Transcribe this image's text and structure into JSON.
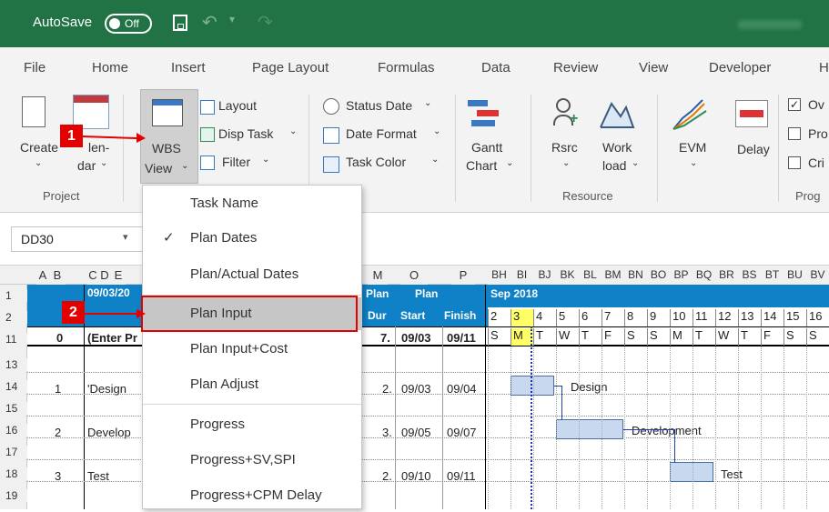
{
  "titlebar": {
    "autosave_label": "AutoSave",
    "toggle_label": "Off"
  },
  "tabs": [
    "File",
    "Home",
    "Insert",
    "Page Layout",
    "Formulas",
    "Data",
    "Review",
    "View",
    "Developer",
    "H"
  ],
  "ribbon": {
    "project": {
      "create": "Create",
      "calendar_line1": "len-",
      "calendar_line2": "dar",
      "group": "Project"
    },
    "wbs": {
      "line1": "WBS",
      "line2": "View"
    },
    "layout": "Layout",
    "disp_task": "Disp Task",
    "filter": "Filter",
    "status_date": "Status Date",
    "date_format": "Date Format",
    "task_color": "Task Color",
    "gantt_line1": "Gantt",
    "gantt_line2": "Chart",
    "rsrc": "Rsrc",
    "work_line1": "Work",
    "work_line2": "load",
    "resource_group": "Resource",
    "evm": "EVM",
    "delay": "Delay",
    "checks": [
      "Ov",
      "Pro",
      "Cri"
    ],
    "prog_group": "Prog"
  },
  "namebox": "DD30",
  "callouts": [
    "1",
    "2"
  ],
  "menu": {
    "items": [
      {
        "label": "Task Name",
        "checked": false
      },
      {
        "label": "Plan Dates",
        "checked": true
      },
      {
        "label": "Plan/Actual Dates",
        "checked": false
      },
      {
        "label": "Plan Input",
        "checked": false,
        "highlighted": true
      },
      {
        "label": "Plan Input+Cost",
        "checked": false
      },
      {
        "label": "Plan Adjust",
        "checked": false
      },
      {
        "label": "Progress",
        "checked": false
      },
      {
        "label": "Progress+SV,SPI",
        "checked": false
      },
      {
        "label": "Progress+CPM Delay",
        "checked": false
      }
    ],
    "check_glyph": "✓"
  },
  "sheet": {
    "col_left": [
      "A",
      "B",
      "C",
      "D",
      "E"
    ],
    "col_mid": [
      "M",
      "O",
      "P"
    ],
    "col_gantt": [
      "BH",
      "BI",
      "BJ",
      "BK",
      "BL",
      "BM",
      "BN",
      "BO",
      "BP",
      "BQ",
      "BR",
      "BS",
      "BT",
      "BU",
      "BV"
    ],
    "rows": [
      "1",
      "2",
      "11",
      "13",
      "14",
      "15",
      "16",
      "17",
      "18",
      "19"
    ],
    "header_date": "09/03/20",
    "plan_top": "Plan",
    "plan_top2": "Plan",
    "dur": "Dur",
    "start": "Start",
    "finish": "Finish",
    "month": "Sep 2018",
    "days": [
      "2",
      "3",
      "4",
      "5",
      "6",
      "7",
      "8",
      "9",
      "10",
      "11",
      "12",
      "13",
      "14",
      "15",
      "16"
    ],
    "weekdays": [
      "S",
      "M",
      "T",
      "W",
      "T",
      "F",
      "S",
      "S",
      "M",
      "T",
      "W",
      "T",
      "F",
      "S",
      "S"
    ],
    "r11": {
      "id": "0",
      "name": "(Enter Pr",
      "dur": "7.",
      "start": "09/03",
      "finish": "09/11"
    },
    "tasks": [
      {
        "id": "1",
        "name": "'Design",
        "dur": "2.",
        "start": "09/03",
        "finish": "09/04",
        "bar_label": "Design"
      },
      {
        "id": "2",
        "name": "Develop",
        "dur": "3.",
        "start": "09/05",
        "finish": "09/07",
        "bar_label": "Development"
      },
      {
        "id": "3",
        "name": "Test",
        "dur": "2.",
        "start": "09/10",
        "finish": "09/11",
        "bar_label": "Test"
      }
    ]
  },
  "colors": {
    "excel_green": "#217346",
    "header_blue": "#0f81c7",
    "callout_red": "#e30000",
    "bar_fill": "#c8d9ef",
    "today_yellow": "#ffff66"
  }
}
